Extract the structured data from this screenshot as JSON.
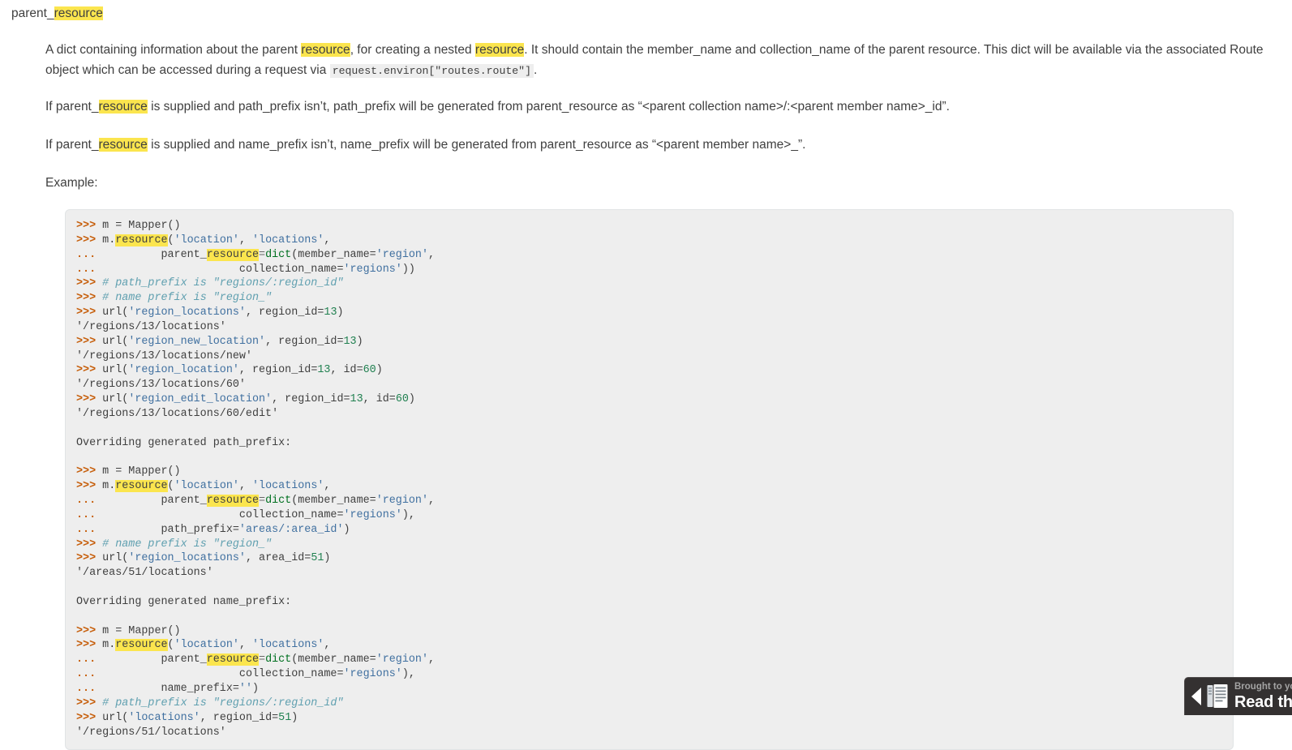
{
  "section": {
    "title_prefix": "parent_",
    "title_highlight": "resource"
  },
  "paragraphs": {
    "p1_a": "A dict containing information about the parent ",
    "p1_hl1": "resource",
    "p1_b": ", for creating a nested ",
    "p1_hl2": "resource",
    "p1_c": ". It should contain the member_name and collection_name of the parent resource. This dict will be available via the associated Route object which can be accessed during a request via ",
    "p1_code": "request.environ[\"routes.route\"]",
    "p1_d": ".",
    "p2_a": "If parent_",
    "p2_hl": "resource",
    "p2_b": " is supplied and path_prefix isn’t, path_prefix will be generated from parent_resource as “<parent collection name>/:<parent member name>_id”.",
    "p3_a": "If parent_",
    "p3_hl": "resource",
    "p3_b": " is supplied and name_prefix isn’t, name_prefix will be generated from parent_resource as “<parent member name>_”.",
    "p4": "Example:"
  },
  "code_block": {
    "language": "python-console",
    "lines": [
      {
        "prompt": ">>> ",
        "tokens": [
          {
            "t": "name",
            "v": "m = Mapper()"
          }
        ]
      },
      {
        "prompt": ">>> ",
        "tokens": [
          {
            "t": "name",
            "v": "m."
          },
          {
            "t": "hl",
            "v": "resource"
          },
          {
            "t": "name",
            "v": "("
          },
          {
            "t": "str",
            "v": "'location'"
          },
          {
            "t": "name",
            "v": ", "
          },
          {
            "t": "str",
            "v": "'locations'"
          },
          {
            "t": "name",
            "v": ","
          }
        ]
      },
      {
        "prompt": "... ",
        "tokens": [
          {
            "t": "name",
            "v": "         parent_"
          },
          {
            "t": "hl",
            "v": "resource"
          },
          {
            "t": "op",
            "v": "="
          },
          {
            "t": "fn",
            "v": "dict"
          },
          {
            "t": "name",
            "v": "(member_name="
          },
          {
            "t": "str",
            "v": "'region'"
          },
          {
            "t": "name",
            "v": ","
          }
        ]
      },
      {
        "prompt": "... ",
        "tokens": [
          {
            "t": "name",
            "v": "                     collection_name="
          },
          {
            "t": "str",
            "v": "'regions'"
          },
          {
            "t": "name",
            "v": "))"
          }
        ]
      },
      {
        "prompt": ">>> ",
        "tokens": [
          {
            "t": "com",
            "v": "# path_prefix is \"regions/:region_id\""
          }
        ]
      },
      {
        "prompt": ">>> ",
        "tokens": [
          {
            "t": "com",
            "v": "# name prefix is \"region_\""
          }
        ]
      },
      {
        "prompt": ">>> ",
        "tokens": [
          {
            "t": "name",
            "v": "url("
          },
          {
            "t": "str",
            "v": "'region_locations'"
          },
          {
            "t": "name",
            "v": ", region_id="
          },
          {
            "t": "num",
            "v": "13"
          },
          {
            "t": "name",
            "v": ")"
          }
        ]
      },
      {
        "prompt": "",
        "tokens": [
          {
            "t": "out",
            "v": "'/regions/13/locations'"
          }
        ]
      },
      {
        "prompt": ">>> ",
        "tokens": [
          {
            "t": "name",
            "v": "url("
          },
          {
            "t": "str",
            "v": "'region_new_location'"
          },
          {
            "t": "name",
            "v": ", region_id="
          },
          {
            "t": "num",
            "v": "13"
          },
          {
            "t": "name",
            "v": ")"
          }
        ]
      },
      {
        "prompt": "",
        "tokens": [
          {
            "t": "out",
            "v": "'/regions/13/locations/new'"
          }
        ]
      },
      {
        "prompt": ">>> ",
        "tokens": [
          {
            "t": "name",
            "v": "url("
          },
          {
            "t": "str",
            "v": "'region_location'"
          },
          {
            "t": "name",
            "v": ", region_id="
          },
          {
            "t": "num",
            "v": "13"
          },
          {
            "t": "name",
            "v": ", id="
          },
          {
            "t": "num",
            "v": "60"
          },
          {
            "t": "name",
            "v": ")"
          }
        ]
      },
      {
        "prompt": "",
        "tokens": [
          {
            "t": "out",
            "v": "'/regions/13/locations/60'"
          }
        ]
      },
      {
        "prompt": ">>> ",
        "tokens": [
          {
            "t": "name",
            "v": "url("
          },
          {
            "t": "str",
            "v": "'region_edit_location'"
          },
          {
            "t": "name",
            "v": ", region_id="
          },
          {
            "t": "num",
            "v": "13"
          },
          {
            "t": "name",
            "v": ", id="
          },
          {
            "t": "num",
            "v": "60"
          },
          {
            "t": "name",
            "v": ")"
          }
        ]
      },
      {
        "prompt": "",
        "tokens": [
          {
            "t": "out",
            "v": "'/regions/13/locations/60/edit'"
          }
        ]
      },
      {
        "prompt": "",
        "tokens": []
      },
      {
        "prompt": "",
        "tokens": [
          {
            "t": "out",
            "v": "Overriding generated path_prefix:"
          }
        ]
      },
      {
        "prompt": "",
        "tokens": []
      },
      {
        "prompt": ">>> ",
        "tokens": [
          {
            "t": "name",
            "v": "m = Mapper()"
          }
        ]
      },
      {
        "prompt": ">>> ",
        "tokens": [
          {
            "t": "name",
            "v": "m."
          },
          {
            "t": "hl",
            "v": "resource"
          },
          {
            "t": "name",
            "v": "("
          },
          {
            "t": "str",
            "v": "'location'"
          },
          {
            "t": "name",
            "v": ", "
          },
          {
            "t": "str",
            "v": "'locations'"
          },
          {
            "t": "name",
            "v": ","
          }
        ]
      },
      {
        "prompt": "... ",
        "tokens": [
          {
            "t": "name",
            "v": "         parent_"
          },
          {
            "t": "hl",
            "v": "resource"
          },
          {
            "t": "op",
            "v": "="
          },
          {
            "t": "fn",
            "v": "dict"
          },
          {
            "t": "name",
            "v": "(member_name="
          },
          {
            "t": "str",
            "v": "'region'"
          },
          {
            "t": "name",
            "v": ","
          }
        ]
      },
      {
        "prompt": "... ",
        "tokens": [
          {
            "t": "name",
            "v": "                     collection_name="
          },
          {
            "t": "str",
            "v": "'regions'"
          },
          {
            "t": "name",
            "v": "),"
          }
        ]
      },
      {
        "prompt": "... ",
        "tokens": [
          {
            "t": "name",
            "v": "         path_prefix="
          },
          {
            "t": "str",
            "v": "'areas/:area_id'"
          },
          {
            "t": "name",
            "v": ")"
          }
        ]
      },
      {
        "prompt": ">>> ",
        "tokens": [
          {
            "t": "com",
            "v": "# name prefix is \"region_\""
          }
        ]
      },
      {
        "prompt": ">>> ",
        "tokens": [
          {
            "t": "name",
            "v": "url("
          },
          {
            "t": "str",
            "v": "'region_locations'"
          },
          {
            "t": "name",
            "v": ", area_id="
          },
          {
            "t": "num",
            "v": "51"
          },
          {
            "t": "name",
            "v": ")"
          }
        ]
      },
      {
        "prompt": "",
        "tokens": [
          {
            "t": "out",
            "v": "'/areas/51/locations'"
          }
        ]
      },
      {
        "prompt": "",
        "tokens": []
      },
      {
        "prompt": "",
        "tokens": [
          {
            "t": "out",
            "v": "Overriding generated name_prefix:"
          }
        ]
      },
      {
        "prompt": "",
        "tokens": []
      },
      {
        "prompt": ">>> ",
        "tokens": [
          {
            "t": "name",
            "v": "m = Mapper()"
          }
        ]
      },
      {
        "prompt": ">>> ",
        "tokens": [
          {
            "t": "name",
            "v": "m."
          },
          {
            "t": "hl",
            "v": "resource"
          },
          {
            "t": "name",
            "v": "("
          },
          {
            "t": "str",
            "v": "'location'"
          },
          {
            "t": "name",
            "v": ", "
          },
          {
            "t": "str",
            "v": "'locations'"
          },
          {
            "t": "name",
            "v": ","
          }
        ]
      },
      {
        "prompt": "... ",
        "tokens": [
          {
            "t": "name",
            "v": "         parent_"
          },
          {
            "t": "hl",
            "v": "resource"
          },
          {
            "t": "op",
            "v": "="
          },
          {
            "t": "fn",
            "v": "dict"
          },
          {
            "t": "name",
            "v": "(member_name="
          },
          {
            "t": "str",
            "v": "'region'"
          },
          {
            "t": "name",
            "v": ","
          }
        ]
      },
      {
        "prompt": "... ",
        "tokens": [
          {
            "t": "name",
            "v": "                     collection_name="
          },
          {
            "t": "str",
            "v": "'regions'"
          },
          {
            "t": "name",
            "v": "),"
          }
        ]
      },
      {
        "prompt": "... ",
        "tokens": [
          {
            "t": "name",
            "v": "         name_prefix="
          },
          {
            "t": "str",
            "v": "''"
          },
          {
            "t": "name",
            "v": ")"
          }
        ]
      },
      {
        "prompt": ">>> ",
        "tokens": [
          {
            "t": "com",
            "v": "# path_prefix is \"regions/:region_id\""
          }
        ]
      },
      {
        "prompt": ">>> ",
        "tokens": [
          {
            "t": "name",
            "v": "url("
          },
          {
            "t": "str",
            "v": "'locations'"
          },
          {
            "t": "name",
            "v": ", region_id="
          },
          {
            "t": "num",
            "v": "51"
          },
          {
            "t": "name",
            "v": ")"
          }
        ]
      },
      {
        "prompt": "",
        "tokens": [
          {
            "t": "out",
            "v": "'/regions/51/locations'"
          }
        ]
      }
    ]
  },
  "rtd_badge": {
    "tagline": "Brought to you by",
    "brand": "Read the Docs",
    "caret": "◀"
  }
}
